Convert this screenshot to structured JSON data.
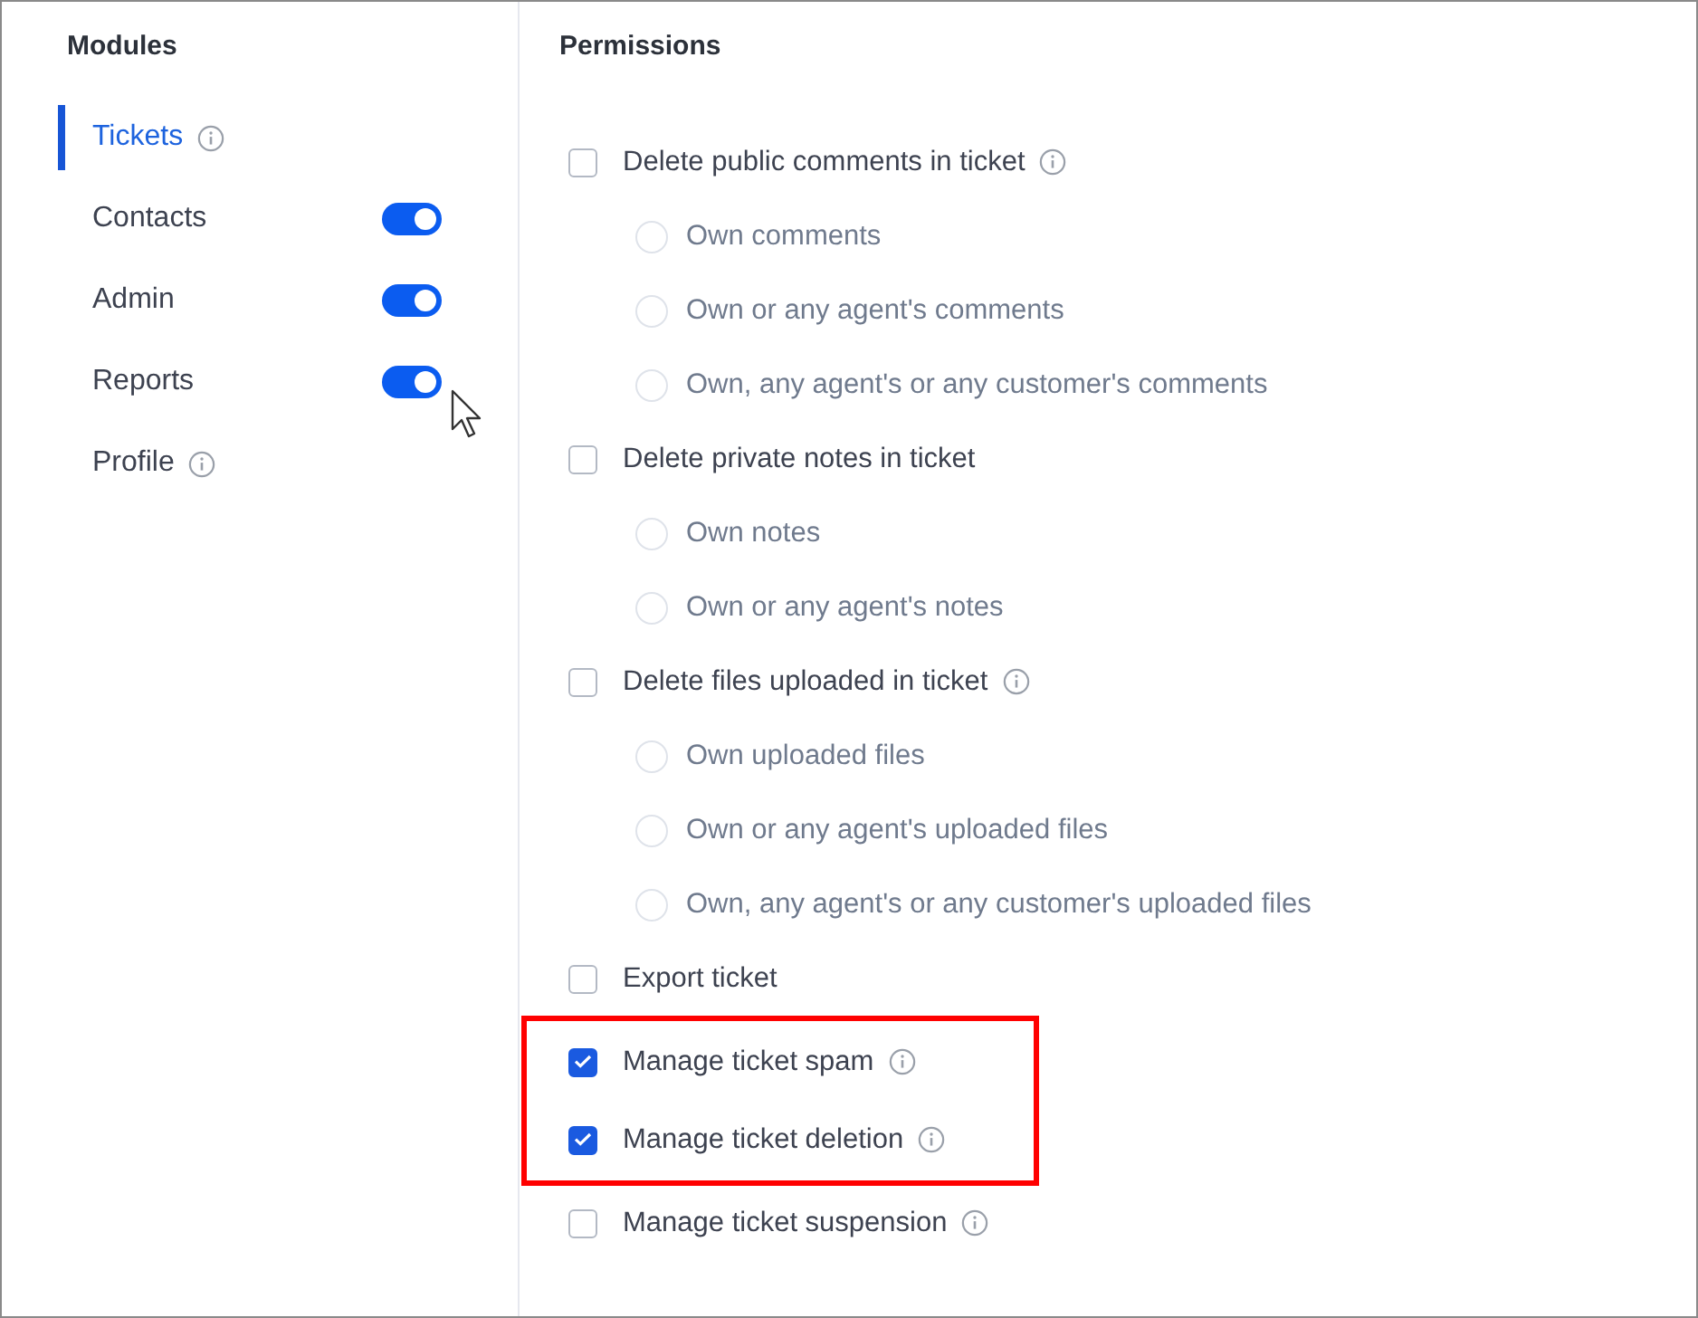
{
  "modules": {
    "title": "Modules",
    "items": [
      {
        "label": "Tickets",
        "selected": true,
        "kind": "info"
      },
      {
        "label": "Contacts",
        "selected": false,
        "kind": "toggle",
        "on": true
      },
      {
        "label": "Admin",
        "selected": false,
        "kind": "toggle",
        "on": true
      },
      {
        "label": "Reports",
        "selected": false,
        "kind": "toggle",
        "on": true
      },
      {
        "label": "Profile",
        "selected": false,
        "kind": "info"
      }
    ]
  },
  "permissions": {
    "title": "Permissions",
    "items": [
      {
        "label": "Delete public comments in ticket",
        "checked": false,
        "info": true,
        "highlighted": false,
        "options": [
          {
            "label": "Own comments",
            "selected": false
          },
          {
            "label": "Own or any agent's comments",
            "selected": false
          },
          {
            "label": "Own, any agent's or any customer's comments",
            "selected": false
          }
        ]
      },
      {
        "label": "Delete private notes in ticket",
        "checked": false,
        "info": false,
        "highlighted": false,
        "options": [
          {
            "label": "Own notes",
            "selected": false
          },
          {
            "label": "Own or any agent's notes",
            "selected": false
          }
        ]
      },
      {
        "label": "Delete files uploaded in ticket",
        "checked": false,
        "info": true,
        "highlighted": false,
        "options": [
          {
            "label": "Own uploaded files",
            "selected": false
          },
          {
            "label": "Own or any agent's uploaded files",
            "selected": false
          },
          {
            "label": "Own, any agent's or any customer's uploaded files",
            "selected": false
          }
        ]
      },
      {
        "label": "Export ticket",
        "checked": false,
        "info": false,
        "highlighted": false
      },
      {
        "label": "Manage ticket spam",
        "checked": true,
        "info": true,
        "highlighted": true
      },
      {
        "label": "Manage ticket deletion",
        "checked": true,
        "info": true,
        "highlighted": true
      },
      {
        "label": "Manage ticket suspension",
        "checked": false,
        "info": true,
        "highlighted": false
      }
    ]
  }
}
